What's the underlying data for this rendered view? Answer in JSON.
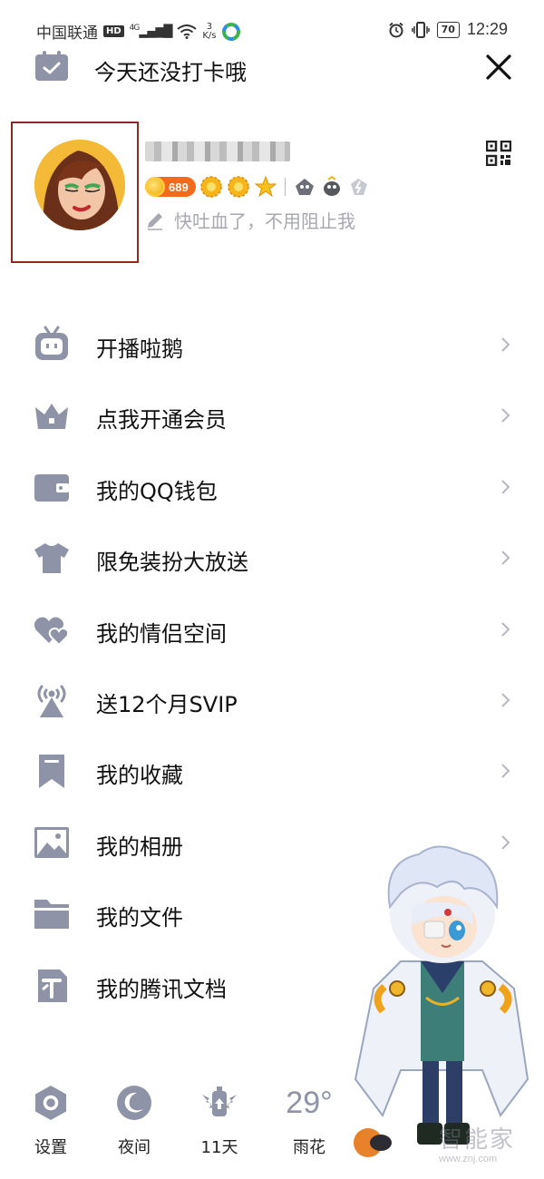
{
  "status_bar": {
    "carrier": "中国联通",
    "hd": "HD",
    "network": "4G",
    "speed_value": "3",
    "speed_unit": "K/s",
    "battery": "70",
    "time": "12:29"
  },
  "header": {
    "signin_prompt": "今天还没打卡哦",
    "calendar_icon": "calendar-icon",
    "close_icon": "close-icon"
  },
  "profile": {
    "coin_count": "689",
    "signature": "快吐血了，不用阻止我",
    "qr_icon": "qr-code-icon"
  },
  "menu": {
    "items": [
      {
        "label": "开播啦鹅",
        "icon": "tv-robot-icon",
        "chevron": true
      },
      {
        "label": "点我开通会员",
        "icon": "crown-icon",
        "chevron": true
      },
      {
        "label": "我的QQ钱包",
        "icon": "wallet-icon",
        "chevron": true
      },
      {
        "label": "限免装扮大放送",
        "icon": "shirt-icon",
        "chevron": true
      },
      {
        "label": "我的情侣空间",
        "icon": "hearts-icon",
        "chevron": true
      },
      {
        "label": "送12个月SVIP",
        "icon": "broadcast-tower-icon",
        "chevron": true
      },
      {
        "label": "我的收藏",
        "icon": "bookmark-icon",
        "chevron": true
      },
      {
        "label": "我的相册",
        "icon": "photo-icon",
        "chevron": true
      },
      {
        "label": "我的文件",
        "icon": "folder-icon",
        "chevron": false
      },
      {
        "label": "我的腾讯文档",
        "icon": "tencent-docs-icon",
        "chevron": false
      }
    ]
  },
  "bottom_bar": {
    "settings_label": "设置",
    "night_label": "夜间",
    "days_label": "11天",
    "temperature": "29°",
    "weather_label": "雨花"
  },
  "watermark": {
    "text": "智能家",
    "url": "www.znj.com"
  },
  "colors": {
    "icon_gray": "#8f93a7",
    "text": "#111111",
    "signature_gray": "#a8a8b2",
    "coin_badge": "#f26b1d",
    "avatar_border": "#8f2a22"
  }
}
